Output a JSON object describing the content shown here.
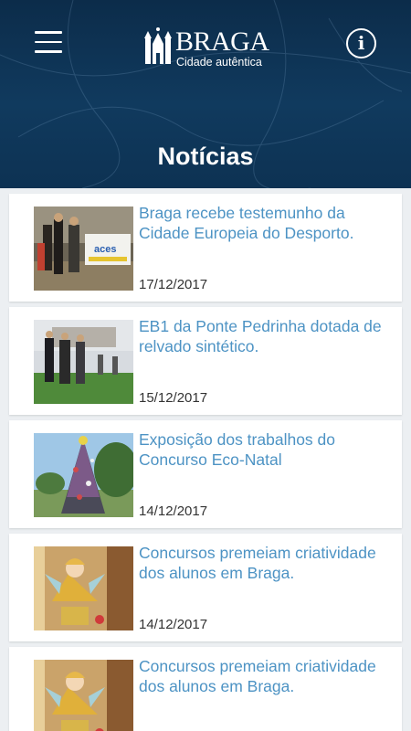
{
  "header": {
    "logo_title": "BRAGA",
    "logo_subtitle": "Cidade autêntica",
    "page_title": "Notícias",
    "menu_icon": "hamburger-menu-icon",
    "info_icon": "info-icon",
    "info_glyph": "i"
  },
  "news": [
    {
      "title": "Braga recebe testemunho da Cidade Europeia do Desporto.",
      "date": "17/12/2017",
      "thumb_banner": "aces"
    },
    {
      "title": "EB1 da Ponte Pedrinha dotada de relvado sintético.",
      "date": "15/12/2017"
    },
    {
      "title": "Exposição dos trabalhos do Concurso Eco-Natal",
      "date": "14/12/2017"
    },
    {
      "title": "Concursos premeiam criatividade dos alunos em Braga.",
      "date": "14/12/2017"
    },
    {
      "title": "Concursos premeiam criatividade dos alunos em Braga.",
      "date": ""
    }
  ],
  "colors": {
    "header_bg": "#0d3253",
    "title_link": "#4d93c4",
    "list_bg": "#eceff2"
  }
}
